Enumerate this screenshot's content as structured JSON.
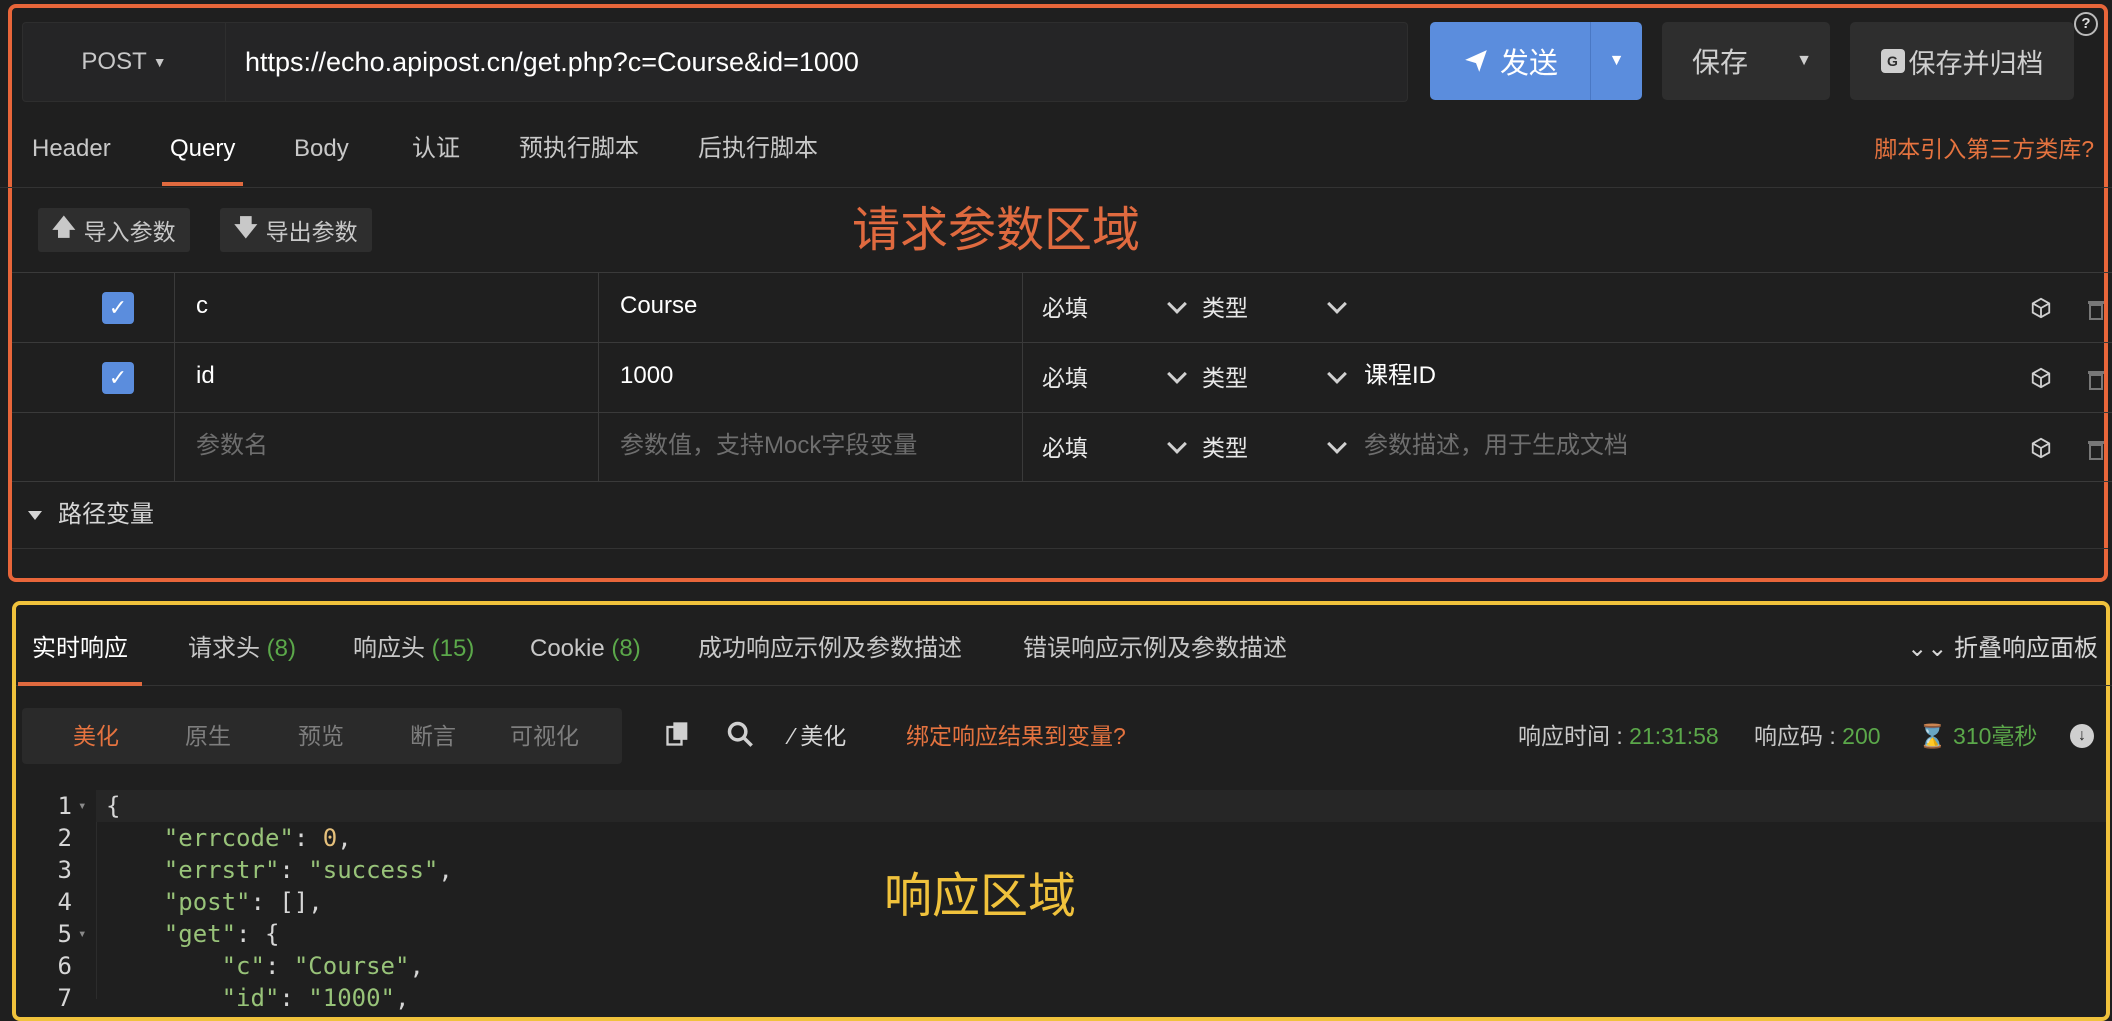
{
  "request": {
    "method": "POST",
    "url": "https://echo.apipost.cn/get.php?c=Course&id=1000",
    "send_label": "发送",
    "save_label": "保存",
    "save_archive_label": "保存并归档",
    "help": "?"
  },
  "req_tabs": [
    "Header",
    "Query",
    "Body",
    "认证",
    "预执行脚本",
    "后执行脚本"
  ],
  "active_req_tab": "Query",
  "third_party_link": "脚本引入第三方类库?",
  "import_params": "导入参数",
  "export_params": "导出参数",
  "region_request": "请求参数区域",
  "region_response": "响应区域",
  "params": [
    {
      "checked": true,
      "name": "c",
      "value": "Course",
      "required": "必填",
      "type": "类型",
      "desc": ""
    },
    {
      "checked": true,
      "name": "id",
      "value": "1000",
      "required": "必填",
      "type": "类型",
      "desc": "课程ID"
    }
  ],
  "params_empty": {
    "name_placeholder": "参数名",
    "value_placeholder": "参数值，支持Mock字段变量",
    "required": "必填",
    "type": "类型",
    "desc_placeholder": "参数描述，用于生成文档"
  },
  "path_variables": "路径变量",
  "res_tabs": [
    {
      "label": "实时响应",
      "count": ""
    },
    {
      "label": "请求头",
      "count": "(8)"
    },
    {
      "label": "响应头",
      "count": "(15)"
    },
    {
      "label": "Cookie",
      "count": "(8)"
    },
    {
      "label": "成功响应示例及参数描述",
      "count": ""
    },
    {
      "label": "错误响应示例及参数描述",
      "count": ""
    }
  ],
  "collapse_panel": "折叠响应面板",
  "view_modes": [
    "美化",
    "原生",
    "预览",
    "断言",
    "可视化"
  ],
  "active_view_mode": "美化",
  "beautify_label": "美化",
  "bind_link": "绑定响应结果到变量?",
  "response_meta": {
    "time_label": "响应时间 : ",
    "time_value": "21:31:58",
    "code_label": "响应码 : ",
    "code_value": "200",
    "duration": "310毫秒"
  },
  "code_lines": [
    {
      "n": "1",
      "fold": true,
      "text": "{"
    },
    {
      "n": "2",
      "fold": false,
      "text": "    \"errcode\": 0,"
    },
    {
      "n": "3",
      "fold": false,
      "text": "    \"errstr\": \"success\","
    },
    {
      "n": "4",
      "fold": false,
      "text": "    \"post\": [],"
    },
    {
      "n": "5",
      "fold": true,
      "text": "    \"get\": {"
    },
    {
      "n": "6",
      "fold": false,
      "text": "        \"c\": \"Course\","
    },
    {
      "n": "7",
      "fold": false,
      "text": "        \"id\": \"1000\","
    }
  ],
  "colors": {
    "accent": "#e06a3f",
    "primary": "#5b8ddd",
    "response_box": "#f0c23c",
    "success": "#5ba84a"
  }
}
